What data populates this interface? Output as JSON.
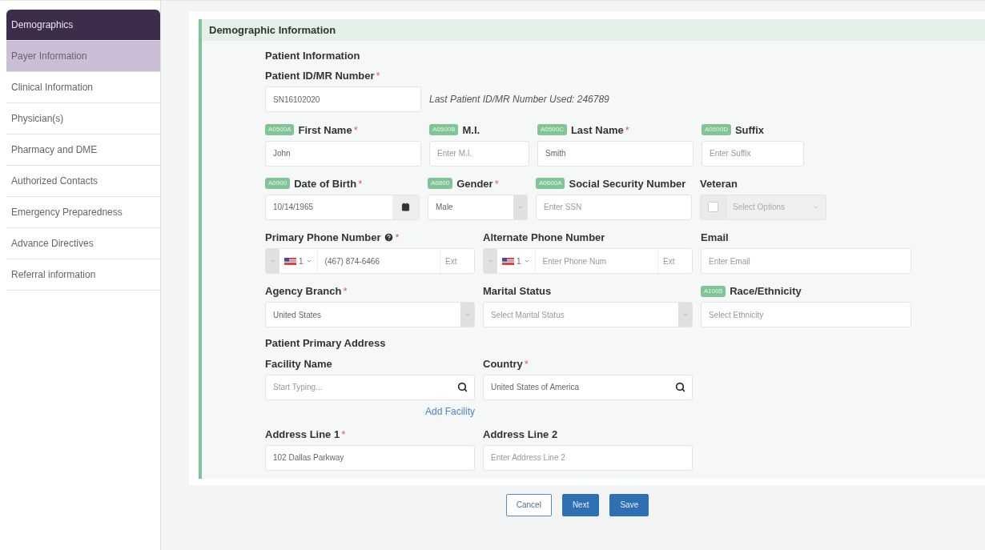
{
  "sidebar": {
    "items": [
      {
        "label": "Demographics",
        "selected": true,
        "highlighted": false
      },
      {
        "label": "Payer Information",
        "selected": false,
        "highlighted": true
      },
      {
        "label": "Clinical Information",
        "selected": false,
        "highlighted": false
      },
      {
        "label": "Physician(s)",
        "selected": false,
        "highlighted": false
      },
      {
        "label": "Pharmacy and DME",
        "selected": false,
        "highlighted": false
      },
      {
        "label": "Authorized Contacts",
        "selected": false,
        "highlighted": false
      },
      {
        "label": "Emergency Preparedness",
        "selected": false,
        "highlighted": false
      },
      {
        "label": "Advance Directives",
        "selected": false,
        "highlighted": false
      },
      {
        "label": "Referral information",
        "selected": false,
        "highlighted": false
      }
    ]
  },
  "section": {
    "title": "Demographic Information",
    "blocks": [
      {
        "kind": "heading",
        "text": "Patient Information"
      },
      {
        "kind": "id",
        "label": "Patient ID/MR Number",
        "required_mark": "*",
        "value": "SN16102020",
        "note": "Last Patient ID/MR Number Used: 246789"
      },
      {
        "kind": "row",
        "fields": [
          {
            "kind": "text",
            "badge": "A0500A",
            "label": "First Name",
            "required_mark": "*",
            "value": "John"
          },
          {
            "kind": "text",
            "badge": "A0500B",
            "label": "M.I.",
            "placeholder": "Enter M.I."
          },
          {
            "kind": "text",
            "badge": "A0500C",
            "label": "Last Name",
            "required_mark": "*",
            "value": "Smith"
          },
          {
            "kind": "text",
            "badge": "A0500D",
            "label": "Suffix",
            "placeholder": "Enter Suffix"
          }
        ]
      },
      {
        "kind": "row",
        "fields": [
          {
            "kind": "date",
            "badge": "A0900",
            "label": "Date of Birth",
            "required_mark": "*",
            "value": "10/14/1965"
          },
          {
            "kind": "select",
            "badge": "A0800",
            "label": "Gender",
            "required_mark": "*",
            "value": "Male"
          },
          {
            "kind": "text",
            "badge": "A0600A",
            "label": "Social Security Number",
            "placeholder": "Enter SSN"
          },
          {
            "kind": "checkselect",
            "label": "Veteran",
            "checked": false,
            "disabled": true,
            "placeholder": "Select Options"
          }
        ]
      },
      {
        "kind": "row",
        "fields": [
          {
            "kind": "phone",
            "label": "Primary Phone Number",
            "help": true,
            "required_mark": "*",
            "dial_code": "1",
            "value": "(467) 874-6466",
            "ext_placeholder": "Ext"
          },
          {
            "kind": "phone",
            "label": "Alternate Phone Number",
            "help": false,
            "dial_code": "1",
            "placeholder": "Enter Phone Num",
            "ext_placeholder": "Ext"
          },
          {
            "kind": "text",
            "label": "Email",
            "placeholder": "Enter Email"
          }
        ]
      },
      {
        "kind": "row",
        "fields": [
          {
            "kind": "select",
            "label": "Agency Branch",
            "required_mark": "*",
            "value": "United States"
          },
          {
            "kind": "select",
            "label": "Marital Status",
            "placeholder": "Select Marital Status"
          },
          {
            "kind": "text",
            "badge": "A1005",
            "label": "Race/Ethnicity",
            "placeholder": "Select Ethnicity"
          }
        ]
      },
      {
        "kind": "heading",
        "text": "Patient Primary Address"
      },
      {
        "kind": "row",
        "fields": [
          {
            "kind": "search",
            "label": "Facility Name",
            "placeholder": "Start Typing...",
            "link": "Add Facility"
          },
          {
            "kind": "search",
            "label": "Country",
            "required_mark": "*",
            "value": "United States of America"
          }
        ]
      },
      {
        "kind": "row",
        "fields": [
          {
            "kind": "text",
            "label": "Address Line 1",
            "required_mark": "*",
            "value": "102 Dallas Parkway"
          },
          {
            "kind": "text",
            "label": "Address Line 2",
            "placeholder": "Enter Address Line 2"
          }
        ]
      }
    ]
  },
  "buttons": [
    {
      "kind": "outline",
      "label": "Cancel"
    },
    {
      "kind": "primary",
      "label": "Next"
    },
    {
      "kind": "primary",
      "label": "Save"
    }
  ]
}
